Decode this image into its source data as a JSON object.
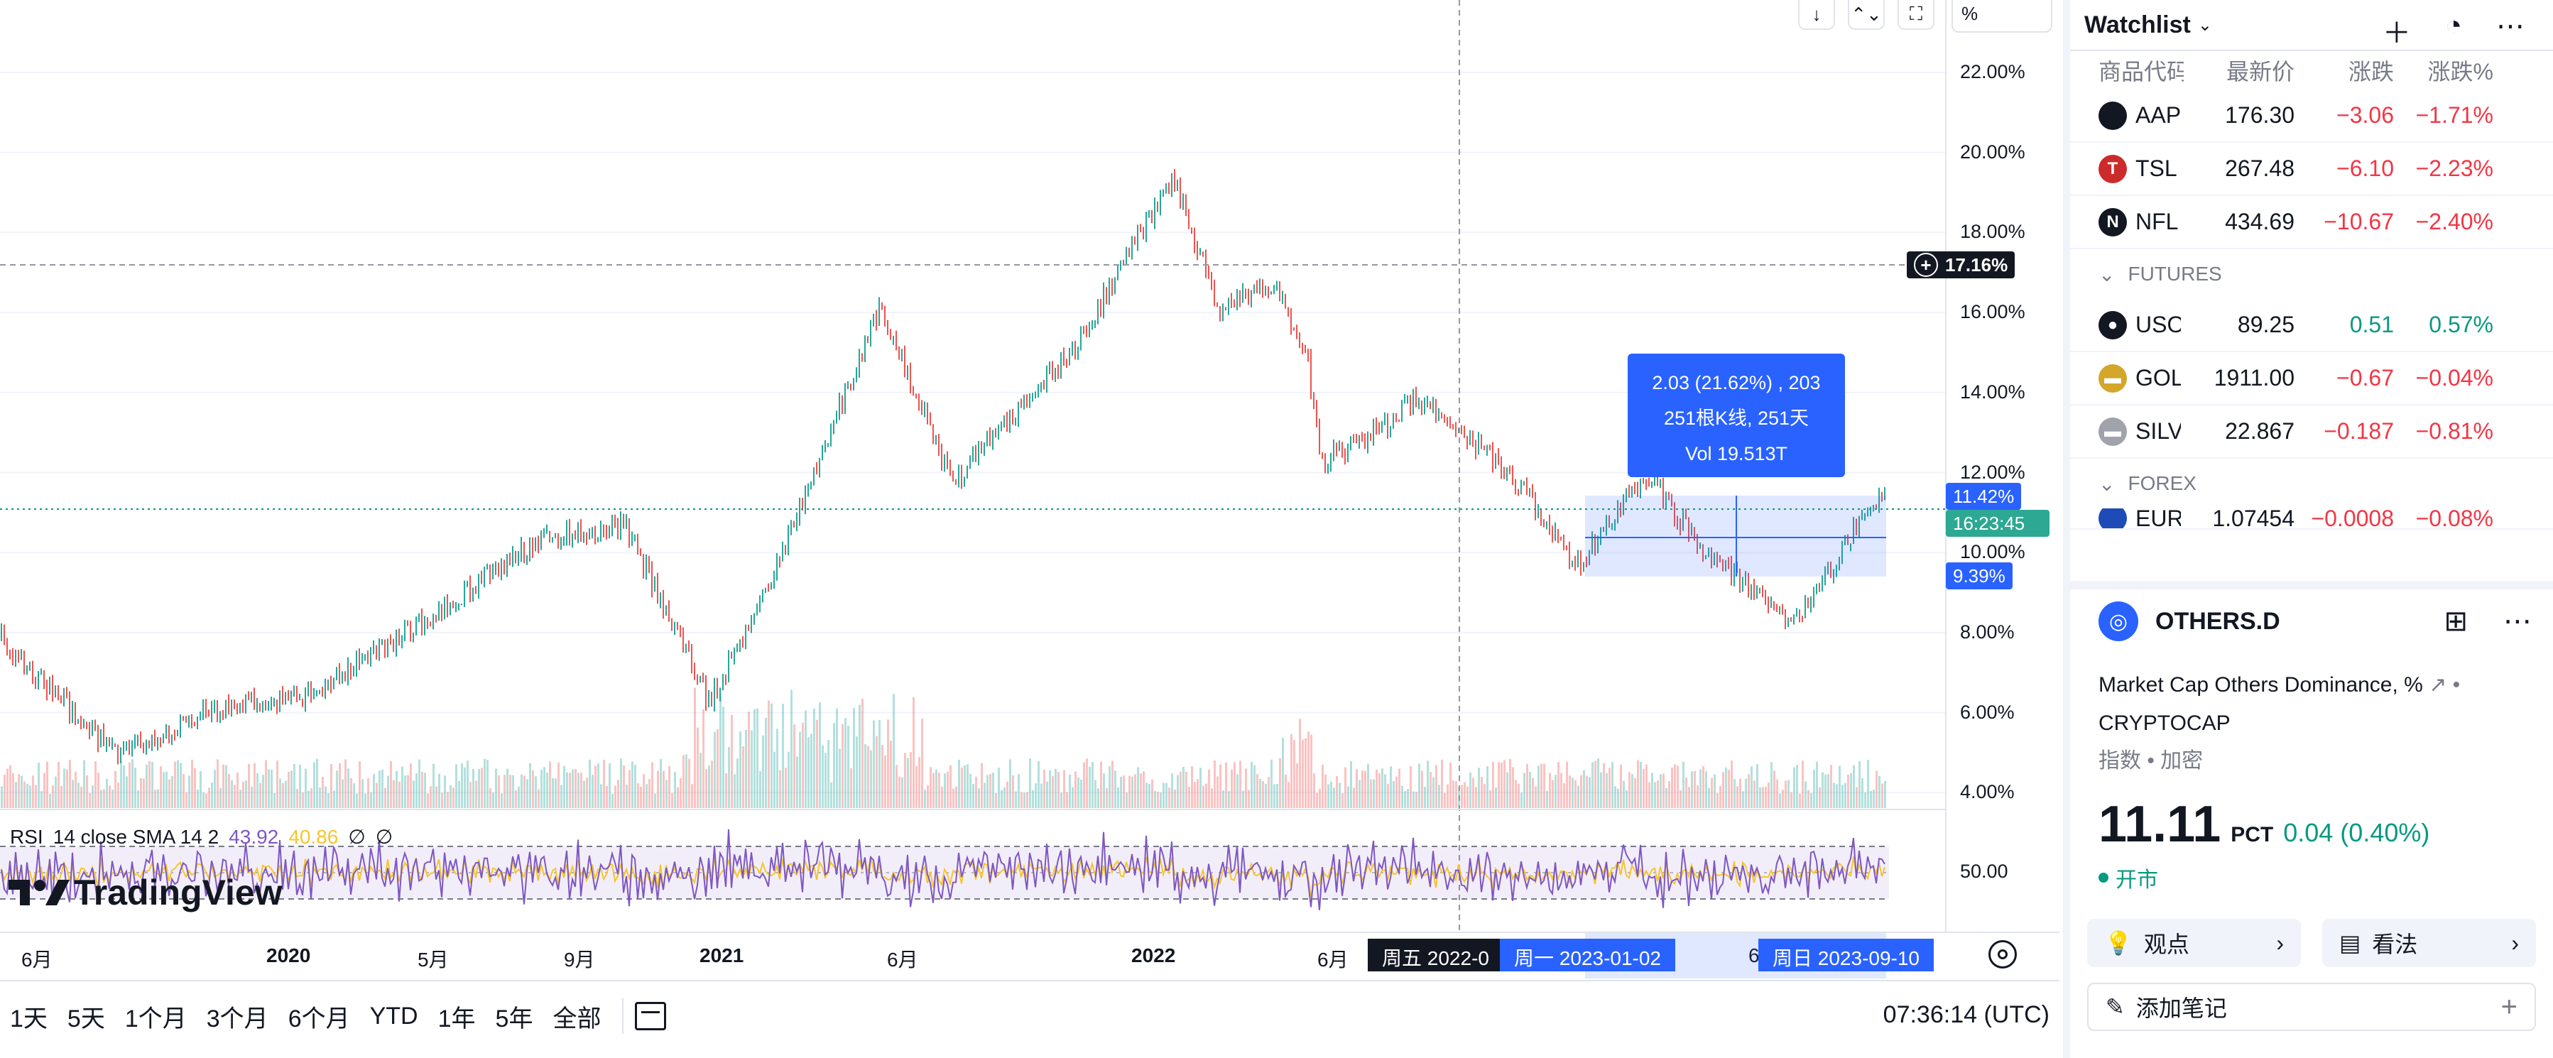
{
  "toolbar": {
    "arrow_down": "↓",
    "collapse": "⌃⌄",
    "fullscreen": "⛶",
    "percent_field": "%"
  },
  "price_scale": [
    "22.00%",
    "20.00%",
    "18.00%",
    "16.00%",
    "14.00%",
    "12.00%",
    "10.00%",
    "8.00%",
    "6.00%",
    "4.00%"
  ],
  "crosshair_price": "17.16%",
  "current_price": "11.42%",
  "current_price_ghost": "11.11%",
  "countdown": "16:23:45",
  "range_low_tag": "9.39%",
  "measure_tooltip": {
    "line1": "2.03 (21.62%) , 203",
    "line2": "251根K线, 251天",
    "line3": "Vol 19.513T"
  },
  "rsi": {
    "name": "RSI",
    "params": "14 close SMA 14 2",
    "value1": "43.92",
    "value2": "40.86",
    "value3": "∅",
    "value4": "∅",
    "level": "50.00"
  },
  "logo_text": "TradingView",
  "time_axis": {
    "ticks": [
      "6月",
      "2020",
      "5月",
      "9月",
      "2021",
      "6月",
      "2022",
      "6月",
      "6"
    ],
    "crosshair_date": "周五 2022-0",
    "range_start": "周一 2023-01-02",
    "range_end": "周日 2023-09-10"
  },
  "ranges": [
    "1天",
    "5天",
    "1个月",
    "3个月",
    "6个月",
    "YTD",
    "1年",
    "5年",
    "全部"
  ],
  "clock": "07:36:14 (UTC)",
  "watchlist": {
    "title": "Watchlist",
    "columns": [
      "商品代码",
      "最新价",
      "涨跌",
      "涨跌%"
    ],
    "stocks": [
      {
        "sym": "AAP",
        "last": "176.30",
        "chg": "−3.06",
        "pct": "−1.71%",
        "icon": "",
        "color": "#131722"
      },
      {
        "sym": "TSL",
        "last": "267.48",
        "chg": "−6.10",
        "pct": "−2.23%",
        "icon": "T",
        "color": "#cc2b2b"
      },
      {
        "sym": "NFL",
        "last": "434.69",
        "chg": "−10.67",
        "pct": "−2.40%",
        "icon": "N",
        "color": "#131722"
      }
    ],
    "futures_label": "FUTURES",
    "futures": [
      {
        "sym": "USOIL",
        "last": "89.25",
        "chg": "0.51",
        "pct": "0.57%",
        "icon": "●",
        "color": "#131722",
        "up": true
      },
      {
        "sym": "GOLD",
        "last": "1911.00",
        "chg": "−0.67",
        "pct": "−0.04%",
        "icon": "▬",
        "color": "#d4a62a",
        "up": false
      },
      {
        "sym": "SILVE",
        "last": "22.867",
        "chg": "−0.187",
        "pct": "−0.81%",
        "icon": "▬",
        "color": "#a0a3ab",
        "up": false
      }
    ],
    "forex_label": "FOREX",
    "forex_partial": {
      "sym": "EURU",
      "last": "1.07454",
      "chg": "−0.0008",
      "pct": "−0.08%"
    }
  },
  "detail": {
    "symbol": "OTHERS.D",
    "description": "Market Cap Others Dominance, %",
    "exchange": "CRYPTOCAP",
    "category": "指数 • 加密",
    "price": "11.11",
    "unit": "PCT",
    "change": "0.04 (0.40%)",
    "status": "开市",
    "ideas": "观点",
    "opinions": "看法",
    "add_note": "添加笔记"
  }
}
